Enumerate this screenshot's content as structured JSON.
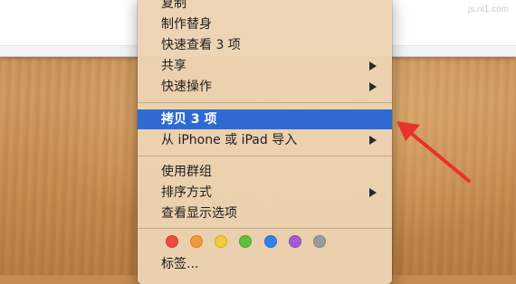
{
  "watermark": "js.ni1.com",
  "menu": {
    "items": [
      {
        "label": "复制",
        "has_submenu": false
      },
      {
        "label": "制作替身",
        "has_submenu": false
      },
      {
        "label": "快速查看 3 项",
        "has_submenu": false
      },
      {
        "label": "共享",
        "has_submenu": true
      },
      {
        "label": "快速操作",
        "has_submenu": true
      },
      {
        "label": "拷贝 3 项",
        "has_submenu": false,
        "selected": true
      },
      {
        "label": "从 iPhone 或 iPad 导入",
        "has_submenu": true
      },
      {
        "label": "使用群组",
        "has_submenu": false
      },
      {
        "label": "排序方式",
        "has_submenu": true
      },
      {
        "label": "查看显示选项",
        "has_submenu": false
      },
      {
        "label": "标签...",
        "has_submenu": false
      }
    ],
    "tag_colors": [
      "#ee4a3f",
      "#f19a38",
      "#f2cc36",
      "#5ec13a",
      "#2e84e8",
      "#a35ad2",
      "#9b9b9b"
    ]
  },
  "colors": {
    "selection": "#2f6ad0",
    "annotation_arrow": "#e8322a"
  }
}
